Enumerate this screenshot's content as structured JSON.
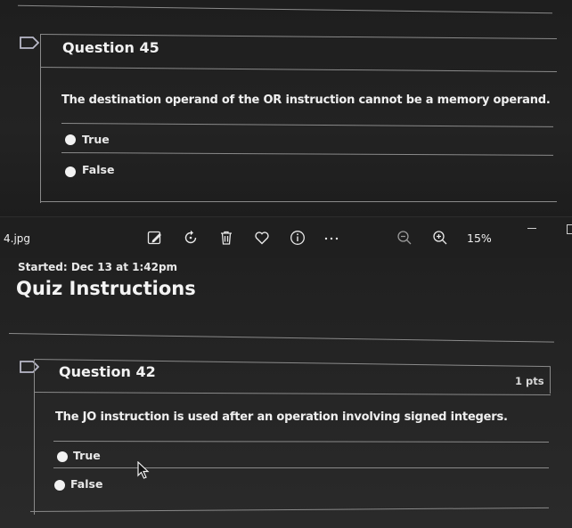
{
  "top_question": {
    "title": "Question 45",
    "text": "The destination operand of the OR instruction cannot be a memory operand.",
    "options": [
      "True",
      "False"
    ]
  },
  "viewer": {
    "filename": "4.jpg",
    "zoom": "15%",
    "icons": [
      "edit-image-icon",
      "rotate-icon",
      "delete-icon",
      "favorite-heart-icon",
      "info-icon",
      "more-icon",
      "zoom-out-icon",
      "zoom-in-icon"
    ]
  },
  "quiz_page": {
    "started": "Started: Dec 13 at 1:42pm",
    "heading": "Quiz Instructions"
  },
  "bottom_question": {
    "title": "Question 42",
    "points": "1 pts",
    "text": "The JO instruction is used after an operation involving signed integers.",
    "options": [
      "True",
      "False"
    ]
  }
}
